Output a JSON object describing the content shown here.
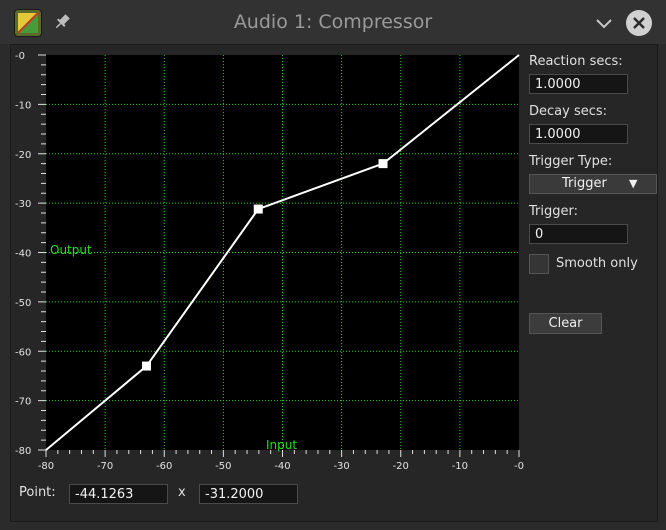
{
  "window": {
    "title": "Audio 1: Compressor",
    "icons": [
      "app-icon",
      "pin-icon",
      "chevron-down-icon",
      "close-icon"
    ]
  },
  "graph": {
    "output_label": "Output",
    "input_label": "Input",
    "y_ticks": [
      "-0",
      "-10",
      "-20",
      "-30",
      "-40",
      "-50",
      "-60",
      "-70",
      "-80"
    ],
    "x_ticks": [
      "-80",
      "-70",
      "-60",
      "-50",
      "-40",
      "-30",
      "-20",
      "-10",
      "-0"
    ],
    "x_range": [
      -80,
      0
    ],
    "y_range": [
      -80,
      0
    ],
    "curve_points": [
      {
        "x": -80,
        "y": -80
      },
      {
        "x": -63,
        "y": -63
      },
      {
        "x": -44.1,
        "y": -31.2
      },
      {
        "x": -23,
        "y": -22
      },
      {
        "x": 0,
        "y": 0
      }
    ],
    "handle_points": [
      1,
      2,
      3
    ],
    "colors": {
      "background": "#000000",
      "grid": "#1fd01f",
      "curve": "#ffffff",
      "label": "#22e022"
    }
  },
  "point": {
    "label": "Point:",
    "x_value": "-44.1263",
    "separator": "x",
    "y_value": "-31.2000"
  },
  "controls": {
    "reaction_label": "Reaction secs:",
    "reaction_value": "1.0000",
    "decay_label": "Decay secs:",
    "decay_value": "1.0000",
    "trigger_type_label": "Trigger Type:",
    "trigger_type_value": "Trigger",
    "trigger_label": "Trigger:",
    "trigger_value": "0",
    "smooth_label": "Smooth only",
    "clear_label": "Clear"
  }
}
